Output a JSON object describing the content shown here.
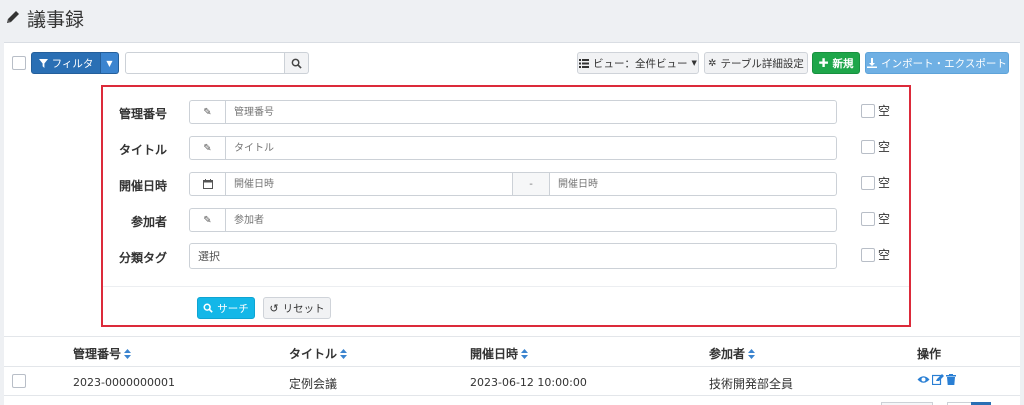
{
  "page": {
    "title": "議事録"
  },
  "toolbar": {
    "filter_label": "フィルタ",
    "search_value": "",
    "view_label": "ビュー：全件ビュー",
    "table_settings_label": "テーブル詳細設定",
    "new_label": "新規",
    "import_export_label": "インポート・エクスポート"
  },
  "filter": {
    "rows": [
      {
        "label": "管理番号",
        "placeholder": "管理番号",
        "empty_label": "空"
      },
      {
        "label": "タイトル",
        "placeholder": "タイトル",
        "empty_label": "空"
      },
      {
        "label": "開催日時",
        "placeholder_from": "開催日時",
        "separator": "-",
        "placeholder_to": "開催日時",
        "empty_label": "空"
      },
      {
        "label": "参加者",
        "placeholder": "参加者",
        "empty_label": "空"
      },
      {
        "label": "分類タグ",
        "select_value": "選択",
        "empty_label": "空"
      }
    ],
    "search_label": "サーチ",
    "reset_label": "リセット"
  },
  "table": {
    "columns": [
      "管理番号",
      "タイトル",
      "開催日時",
      "参加者",
      "操作"
    ],
    "rows": [
      {
        "id": "2023-0000000001",
        "title": "定例会議",
        "datetime": "2023-06-12 10:00:00",
        "participants": "技術開発部全員"
      }
    ]
  },
  "colors": {
    "primary": "#2a6fb4",
    "success": "#1ea64a",
    "info": "#13b7e8",
    "import": "#6fb0e4",
    "highlight": "#dc2a3a"
  }
}
